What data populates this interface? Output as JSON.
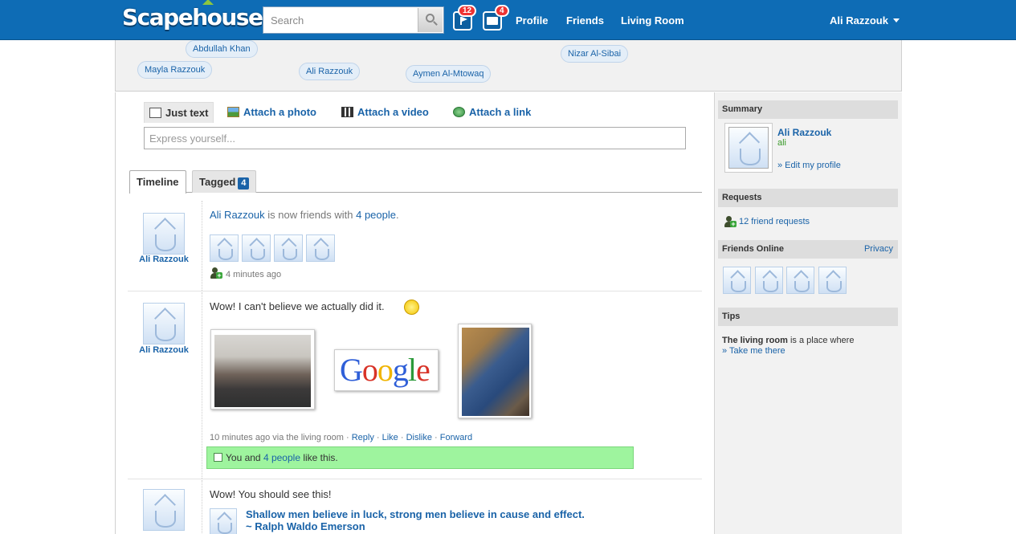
{
  "app": {
    "logo": "Scapehouse"
  },
  "search": {
    "placeholder": "Search"
  },
  "notifications": {
    "flag_count": "12",
    "mail_count": "4"
  },
  "nav": {
    "profile": "Profile",
    "friends": "Friends",
    "living_room": "Living Room",
    "user": "Ali Razzouk"
  },
  "strip_people": [
    "Abdullah Khan",
    "Mayla Razzouk",
    "Ali Razzouk",
    "Aymen Al-Mtowaq",
    "Nizar Al-Sibai"
  ],
  "composer": {
    "tabs": [
      "Just text",
      "Attach a photo",
      "Attach a video",
      "Attach a link"
    ],
    "placeholder": "Express yourself..."
  },
  "feed_tabs": {
    "timeline": "Timeline",
    "tagged": "Tagged",
    "tagged_count": "4"
  },
  "posts": [
    {
      "author": "Ali Razzouk",
      "text_mid": "is now friends with",
      "text_link": "4 people",
      "text_end": ".",
      "time": "4 minutes ago"
    },
    {
      "author": "Ali Razzouk",
      "text": "Wow! I can't believe we actually did it.",
      "meta": "10 minutes ago via the living room",
      "actions": [
        "Reply",
        "Like",
        "Dislike",
        "Forward"
      ],
      "likes_pre": "You and",
      "likes_link": "4 people",
      "likes_post": "like this.",
      "google_letters": [
        "G",
        "o",
        "o",
        "g",
        "l",
        "e"
      ]
    },
    {
      "author": "Ali Razzouk",
      "text": "Wow! You should see this!",
      "quote_line1": "Shallow men believe in luck, strong men believe in cause and effect.",
      "quote_line2": "~ Ralph Waldo Emerson"
    }
  ],
  "sidebar": {
    "summary_title": "Summary",
    "profile_name": "Ali Razzouk",
    "profile_username": "ali",
    "edit_profile": "» Edit my profile",
    "requests_title": "Requests",
    "requests_link": "12 friend requests",
    "online_title": "Friends Online",
    "privacy": "Privacy",
    "tips_title": "Tips",
    "tips_bold": "The living room",
    "tips_text": "is a place where",
    "tips_link": "» Take me there"
  },
  "colors": {
    "topbar": "#0e6cb5",
    "link": "#1a63a8",
    "like_bar": "#9ef49e",
    "badge": "#e33333"
  }
}
